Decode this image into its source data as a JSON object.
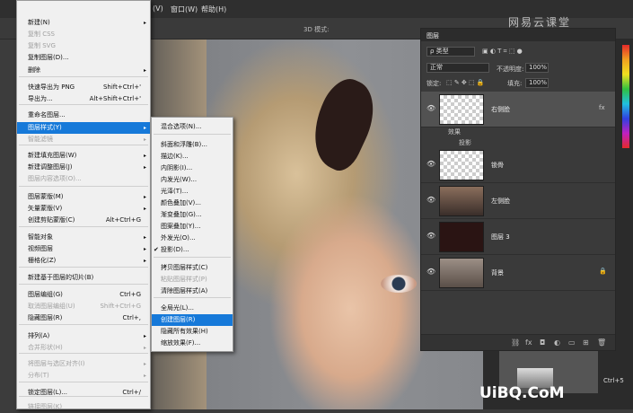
{
  "menubar": {
    "items": [
      "(V)",
      "窗口(W)",
      "帮助(H)"
    ]
  },
  "optbar": {
    "label_3d": "3D 模式:"
  },
  "brand": {
    "logo": "网易云课堂",
    "watermark": "UiBQ.CoM"
  },
  "menu1": {
    "items": [
      {
        "label": "新建(N)",
        "arrow": "▸"
      },
      {
        "label": "复制 CSS",
        "disabled": true
      },
      {
        "label": "复制 SVG",
        "disabled": true
      },
      {
        "label": "复制图层(D)..."
      },
      {
        "label": "删除",
        "arrow": "▸"
      },
      {
        "label": "快速导出为 PNG",
        "shortcut": "Shift+Ctrl+'"
      },
      {
        "label": "导出为...",
        "shortcut": "Alt+Shift+Ctrl+'"
      },
      {
        "label": "重命名图层..."
      },
      {
        "label": "图层样式(Y)",
        "arrow": "▸",
        "highlight": true
      },
      {
        "label": "智能滤镜",
        "arrow": "▸",
        "disabled": true
      },
      {
        "label": "新建填充图层(W)",
        "arrow": "▸"
      },
      {
        "label": "新建调整图层(J)",
        "arrow": "▸"
      },
      {
        "label": "图层内容选项(O)...",
        "disabled": true
      },
      {
        "label": "图层蒙版(M)",
        "arrow": "▸"
      },
      {
        "label": "矢量蒙版(V)",
        "arrow": "▸"
      },
      {
        "label": "创建剪贴蒙版(C)",
        "shortcut": "Alt+Ctrl+G"
      },
      {
        "label": "智能对象",
        "arrow": "▸"
      },
      {
        "label": "视频图层",
        "arrow": "▸"
      },
      {
        "label": "栅格化(Z)",
        "arrow": "▸"
      },
      {
        "label": "新建基于图层的切片(B)"
      },
      {
        "label": "图层编组(G)",
        "shortcut": "Ctrl+G"
      },
      {
        "label": "取消图层编组(U)",
        "shortcut": "Shift+Ctrl+G",
        "disabled": true
      },
      {
        "label": "隐藏图层(R)",
        "shortcut": "Ctrl+,"
      },
      {
        "label": "排列(A)",
        "arrow": "▸"
      },
      {
        "label": "合并形状(H)",
        "arrow": "▸",
        "disabled": true
      },
      {
        "label": "将图层与选区对齐(I)",
        "arrow": "▸",
        "disabled": true
      },
      {
        "label": "分布(T)",
        "arrow": "▸",
        "disabled": true
      },
      {
        "label": "锁定图层(L)...",
        "shortcut": "Ctrl+/"
      },
      {
        "label": "链接图层(K)",
        "disabled": true
      }
    ]
  },
  "menu2": {
    "items": [
      {
        "label": "混合选项(N)..."
      },
      {
        "label": "斜面和浮雕(B)..."
      },
      {
        "label": "描边(K)..."
      },
      {
        "label": "内阴影(I)..."
      },
      {
        "label": "内发光(W)..."
      },
      {
        "label": "光泽(T)..."
      },
      {
        "label": "颜色叠加(V)..."
      },
      {
        "label": "渐变叠加(G)..."
      },
      {
        "label": "图案叠加(Y)..."
      },
      {
        "label": "外发光(O)..."
      },
      {
        "label": "投影(D)...",
        "checked": "✔"
      },
      {
        "label": "拷贝图层样式(C)"
      },
      {
        "label": "粘贴图层样式(P)",
        "disabled": true
      },
      {
        "label": "清除图层样式(A)"
      },
      {
        "label": "全局光(L)..."
      },
      {
        "label": "创建图层(R)",
        "highlight": true
      },
      {
        "label": "隐藏所有效果(H)"
      },
      {
        "label": "缩放效果(F)..."
      }
    ]
  },
  "panel": {
    "title": "图层",
    "filter": "ρ 类型",
    "blend_mode": "正常",
    "opacity_label": "不透明度:",
    "opacity": "100%",
    "lock_label": "锁定:",
    "fill_label": "填充:",
    "fill": "100%",
    "layers": [
      {
        "name": "右侧脸",
        "fx": "fx",
        "selected": true
      },
      {
        "name": "锁骨"
      },
      {
        "name": "左侧脸"
      },
      {
        "name": "图层 3"
      },
      {
        "name": "背景",
        "lock": "🔒"
      }
    ],
    "effects_label": "效果",
    "effect_item": "投影"
  },
  "footer": {
    "shortcut_hint": "Ctrl+5"
  }
}
